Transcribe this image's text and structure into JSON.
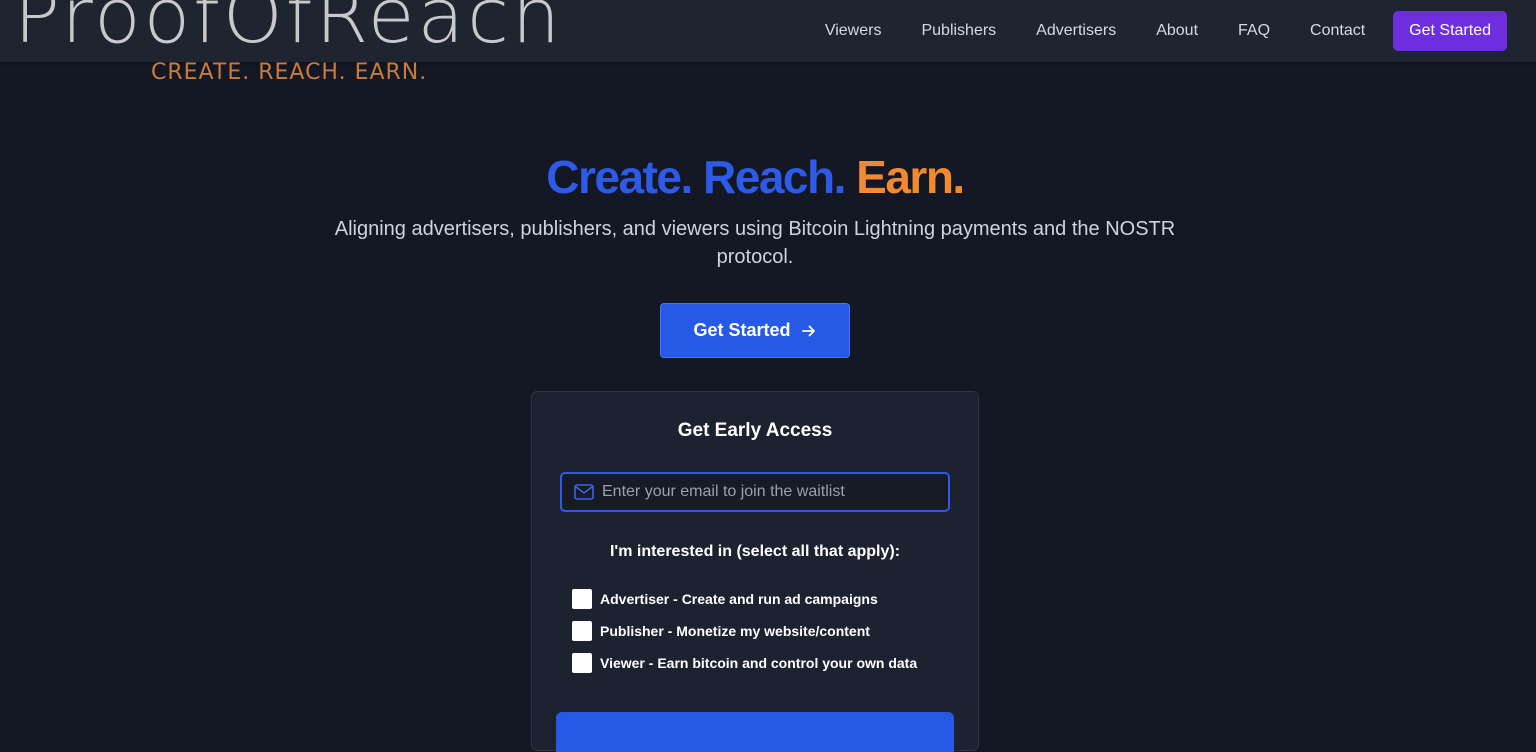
{
  "brand": {
    "wordmark": "ProofOfReach",
    "tagline": "CREATE. REACH. EARN."
  },
  "nav": {
    "links": [
      "Viewers",
      "Publishers",
      "Advertisers",
      "About",
      "FAQ",
      "Contact"
    ],
    "cta": "Get Started"
  },
  "hero": {
    "title_parts": [
      "Create.",
      "Reach.",
      "Earn."
    ],
    "subtitle": "Aligning advertisers, publishers, and viewers using Bitcoin Lightning payments and the NOSTR protocol.",
    "button_label": "Get Started"
  },
  "waitlist": {
    "title": "Get Early Access",
    "email_placeholder": "Enter your email to join the waitlist",
    "interest_label": "I'm interested in (select all that apply):",
    "options": [
      "Advertiser - Create and run ad campaigns",
      "Publisher - Monetize my website/content",
      "Viewer - Earn bitcoin and control your own data"
    ]
  },
  "colors": {
    "nav_cta": "#6d2ee0",
    "primary_blue": "#2659e6",
    "accent_orange": "#f0892f",
    "page_bg": "#141824"
  },
  "icons": {
    "hero_button": "arrow-right-icon",
    "email_field": "mail-icon"
  }
}
